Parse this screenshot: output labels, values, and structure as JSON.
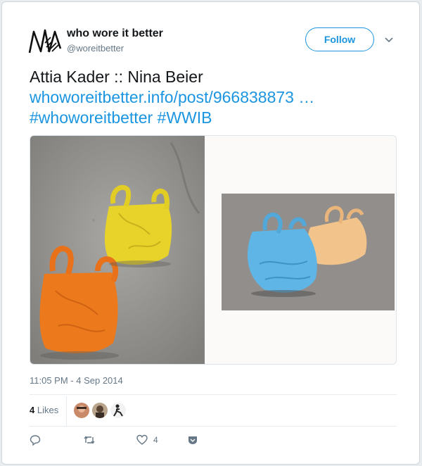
{
  "tweet": {
    "author_name": "who wore it better",
    "author_handle": "@woreitbetter",
    "follow_label": "Follow",
    "text": "Attia Kader :: Nina Beier",
    "link_url": "whoworeitbetter.info/post/966838873 …",
    "hashtags": "#whoworeitbetter #WWIB",
    "timestamp": "11:05 PM - 4 Sep 2014",
    "likes_count": "4",
    "likes_label": "Likes",
    "like_action_count": "4"
  },
  "icons": {
    "logo": "nw-scribble-logo",
    "menu": "chevron-down-icon",
    "reply": "reply-icon",
    "retweet": "retweet-icon",
    "like": "heart-icon",
    "share": "share-icon"
  },
  "colors": {
    "link": "#1b95e0",
    "text": "#14171a",
    "muted": "#657786"
  }
}
